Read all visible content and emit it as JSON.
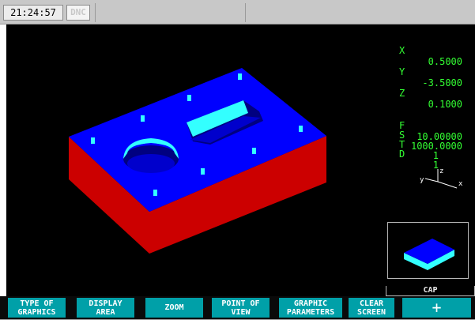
{
  "status_bar": {
    "time": "21:24:57",
    "mode_badge": "DNC"
  },
  "readout": {
    "x_label": "X",
    "x_value": "0.5000",
    "y_label": "Y",
    "y_value": "-3.5000",
    "z_label": "Z",
    "z_value": "0.1000",
    "f_label": "F",
    "f_value": "10.00000",
    "s_label": "S",
    "s_value": "1000.0000",
    "t_label": "T",
    "t_value": "1",
    "d_label": "D",
    "d_value": "1"
  },
  "axis_indicator": {
    "z": "z",
    "y": "y",
    "x": "x"
  },
  "cap_window": {
    "label": "CAP"
  },
  "softkeys": [
    {
      "label": "TYPE OF\nGRAPHICS"
    },
    {
      "label": "DISPLAY\nAREA"
    },
    {
      "label": "ZOOM"
    },
    {
      "label": "POINT OF\nVIEW"
    },
    {
      "label": "GRAPHIC\nPARAMETERS"
    },
    {
      "label": "CLEAR\nSCREEN"
    },
    {
      "label": "+"
    }
  ],
  "colors": {
    "part_top": "#0000ff",
    "part_side": "#cc0000",
    "pocket_wall": "#33ffff",
    "readout_text": "#33ff33",
    "softkey_bg": "#00a0a8",
    "cap_top": "#0000ff",
    "cap_side": "#33ffff"
  }
}
